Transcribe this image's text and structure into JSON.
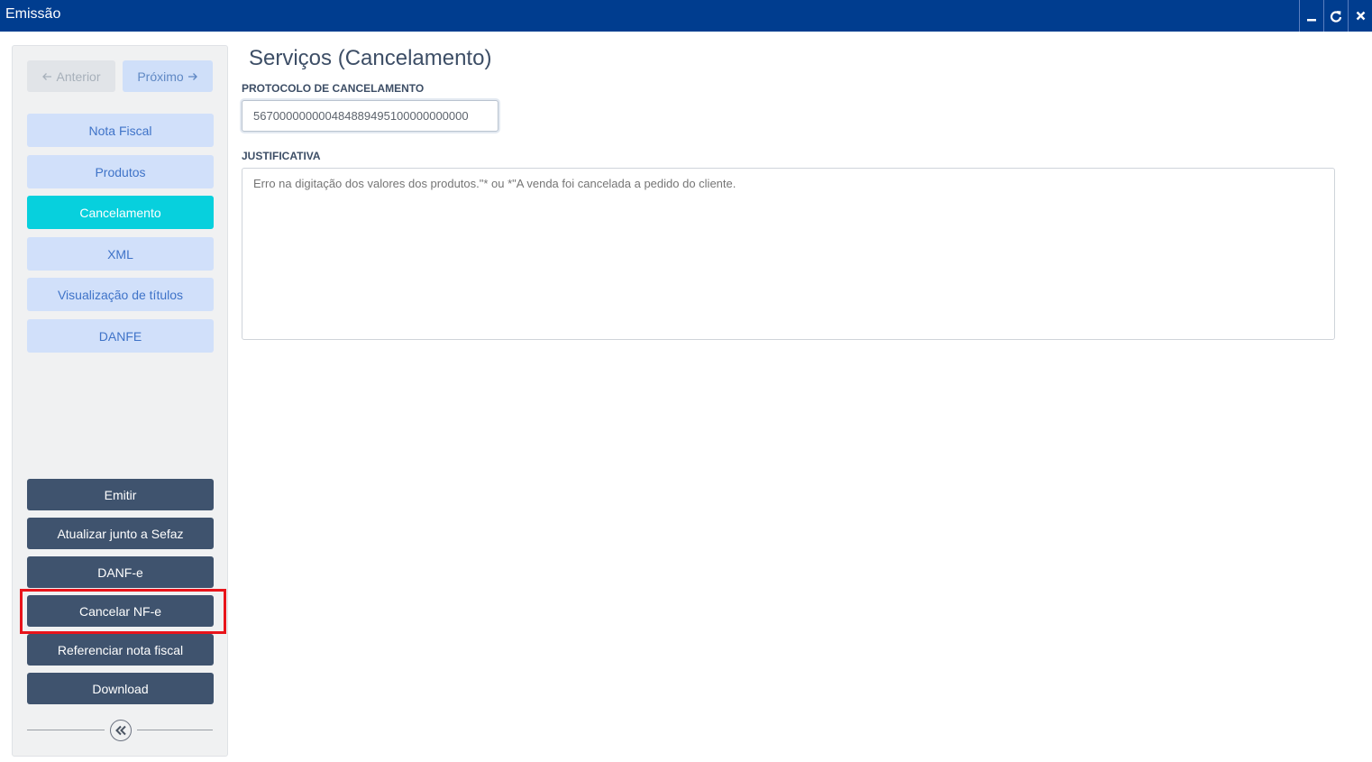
{
  "window": {
    "title": "Emissão",
    "controls": [
      "minimize-icon",
      "refresh-icon",
      "close-icon"
    ]
  },
  "sidebar": {
    "nav": {
      "prev_label": "Anterior",
      "next_label": "Próximo"
    },
    "menu": [
      {
        "label": "Nota Fiscal",
        "active": false
      },
      {
        "label": "Produtos",
        "active": false
      },
      {
        "label": "Cancelamento",
        "active": true
      },
      {
        "label": "XML",
        "active": false
      },
      {
        "label": "Visualização de títulos",
        "active": false
      },
      {
        "label": "DANFE",
        "active": false
      }
    ],
    "actions": [
      {
        "label": "Emitir"
      },
      {
        "label": "Atualizar junto a Sefaz"
      },
      {
        "label": "DANF-e"
      },
      {
        "label": "Cancelar NF-e",
        "highlighted": true
      },
      {
        "label": "Referenciar nota fiscal"
      },
      {
        "label": "Download"
      }
    ]
  },
  "main": {
    "title": "Serviços (Cancelamento)",
    "protocol": {
      "label": "PROTOCOLO DE CANCELAMENTO",
      "value": "567000000000484889495100000000000"
    },
    "justification": {
      "label": "JUSTIFICATIVA",
      "placeholder": "Erro na digitação dos valores dos produtos.\"* ou *\"A venda foi cancelada a pedido do cliente."
    }
  },
  "colors": {
    "titlebar": "#003d8f",
    "active_menu": "#07d0dd",
    "menu_button": "#d1e0fa",
    "action_button": "#3f536e",
    "highlight_border": "#e8141b"
  }
}
